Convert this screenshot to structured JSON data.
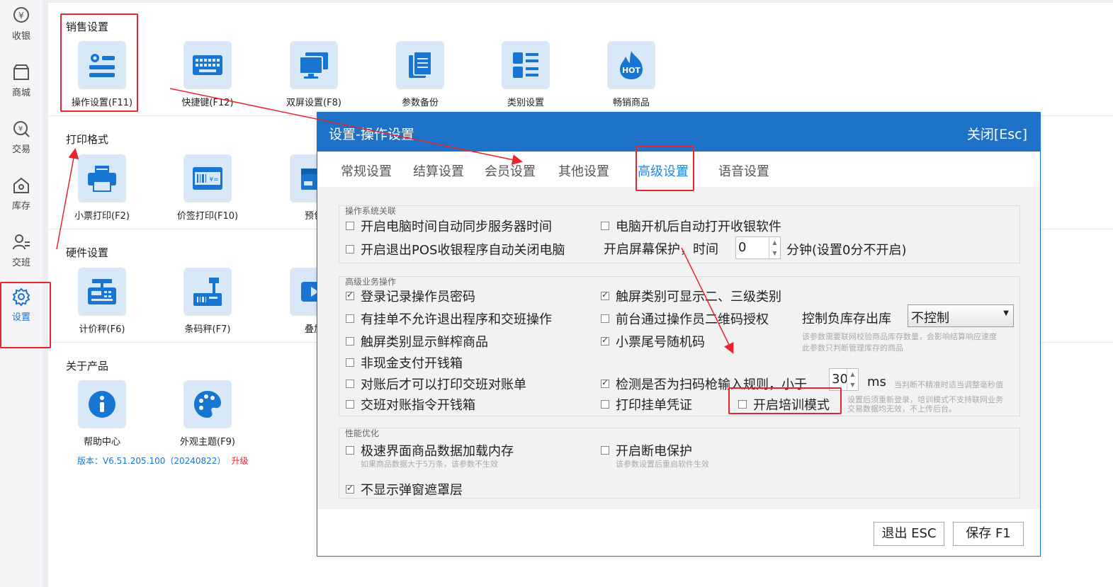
{
  "sidebar": {
    "items": [
      {
        "label": "收银",
        "icon": "cash-icon"
      },
      {
        "label": "商城",
        "icon": "store-icon"
      },
      {
        "label": "交易",
        "icon": "transaction-icon"
      },
      {
        "label": "库存",
        "icon": "warehouse-icon"
      },
      {
        "label": "交班",
        "icon": "shift-icon"
      },
      {
        "label": "设置",
        "icon": "gear-icon",
        "active": true
      }
    ]
  },
  "sections": {
    "sales": {
      "title": "销售设置",
      "tiles": [
        "操作设置(F11)",
        "快捷键(F12)",
        "双屏设置(F8)",
        "参数备份",
        "类别设置",
        "畅销商品"
      ]
    },
    "print": {
      "title": "打印格式",
      "tiles": [
        "小票打印(F2)",
        "价签打印(F10)",
        "预包"
      ]
    },
    "hardware": {
      "title": "硬件设置",
      "tiles": [
        "计价秤(F6)",
        "条码秤(F7)",
        "叠加"
      ]
    },
    "about": {
      "title": "关于产品",
      "tiles": [
        "帮助中心",
        "外观主题(F9)"
      ]
    }
  },
  "hot_badge": "HOT",
  "version": {
    "text": "版本：V6.51.205.100（20240822）",
    "upgrade": "升级"
  },
  "dialog": {
    "title": "设置-操作设置",
    "close": "关闭[Esc]",
    "tabs": [
      "常规设置",
      "结算设置",
      "会员设置",
      "其他设置",
      "高级设置",
      "语音设置"
    ],
    "groups": {
      "os": {
        "title": "操作系统关联",
        "opt1": "开启电脑时间自动同步服务器时间",
        "opt2": "电脑开机后自动打开收银软件",
        "opt3": "开启退出POS收银程序自动关闭电脑",
        "screensaver": "开启屏幕保护，时间",
        "screensaver_value": "0",
        "screensaver_unit": "分钟(设置0分不开启)"
      },
      "biz": {
        "title": "高级业务操作",
        "opt1": "登录记录操作员密码",
        "opt2": "触屏类别可显示二、三级类别",
        "opt3": "有挂单不允许退出程序和交班操作",
        "opt4": "前台通过操作员二维码授权",
        "stock_label": "控制负库存出库",
        "stock_value": "不控制",
        "stock_hint1": "该参数需要联网校验商品库存数量，会影响结算响应速度",
        "stock_hint2": "此参数只判断管理库存的商品",
        "opt5": "触屏类别显示鲜榨商品",
        "opt6": "小票尾号随机码",
        "opt7": "非现金支付开钱箱",
        "opt8": "对账后才可以打印交班对账单",
        "opt9": "检测是否为扫码枪输入规则，小于",
        "scan_value": "30",
        "scan_unit": "ms",
        "scan_hint": "当判断不精准时适当调整毫秒值",
        "opt10": "交班对账指令开钱箱",
        "opt11": "打印挂单凭证",
        "opt12": "开启培训模式",
        "train_hint1": "设置后须重新登录，培训模式不支持联网业务",
        "train_hint2": "交易数据均无效，不上传后台。"
      },
      "perf": {
        "title": "性能优化",
        "opt1": "极速界面商品数据加载内存",
        "opt1_hint": "如果商品数据大于5万条，该参数不生效",
        "opt2": "开启断电保护",
        "opt2_hint": "该参数设置后重启软件生效",
        "opt3": "不显示弹窗遮罩层"
      }
    },
    "buttons": {
      "exit": "退出 ESC",
      "save": "保存 F1"
    }
  },
  "colors": {
    "accent": "#1e72c8",
    "highlight": "#e8242e",
    "tile_bg": "#d8e8f6",
    "icon": "#1876d2"
  }
}
